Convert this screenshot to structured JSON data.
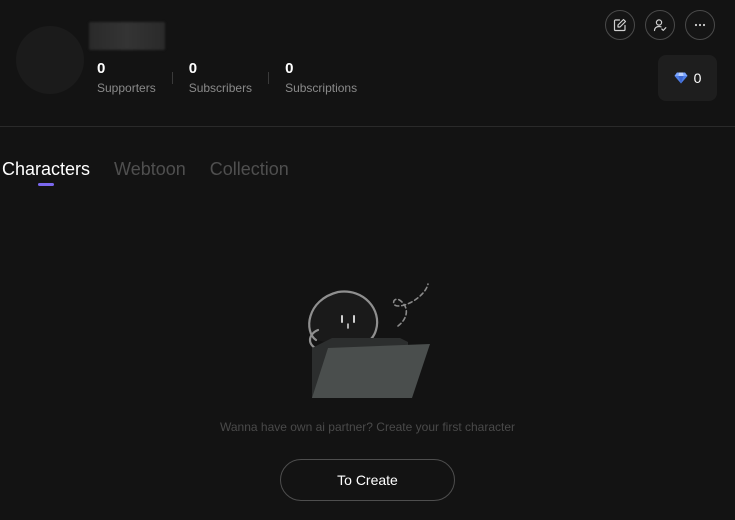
{
  "profile": {
    "stats": [
      {
        "value": "0",
        "label": "Supporters"
      },
      {
        "value": "0",
        "label": "Subscribers"
      },
      {
        "value": "0",
        "label": "Subscriptions"
      }
    ]
  },
  "header": {
    "buttons": [
      {
        "icon": "edit-icon"
      },
      {
        "icon": "user-check-icon"
      },
      {
        "icon": "more-icon"
      }
    ],
    "gems": {
      "icon": "diamond-icon",
      "count": "0"
    }
  },
  "tabs": [
    {
      "label": "Characters",
      "active": true
    },
    {
      "label": "Webtoon",
      "active": false
    },
    {
      "label": "Collection",
      "active": false
    }
  ],
  "empty_state": {
    "message": "Wanna have own ai partner? Create your first character",
    "button_label": "To Create"
  },
  "colors": {
    "background": "#131313",
    "accent": "#7b68ee",
    "muted_text": "#8a8a8a"
  }
}
